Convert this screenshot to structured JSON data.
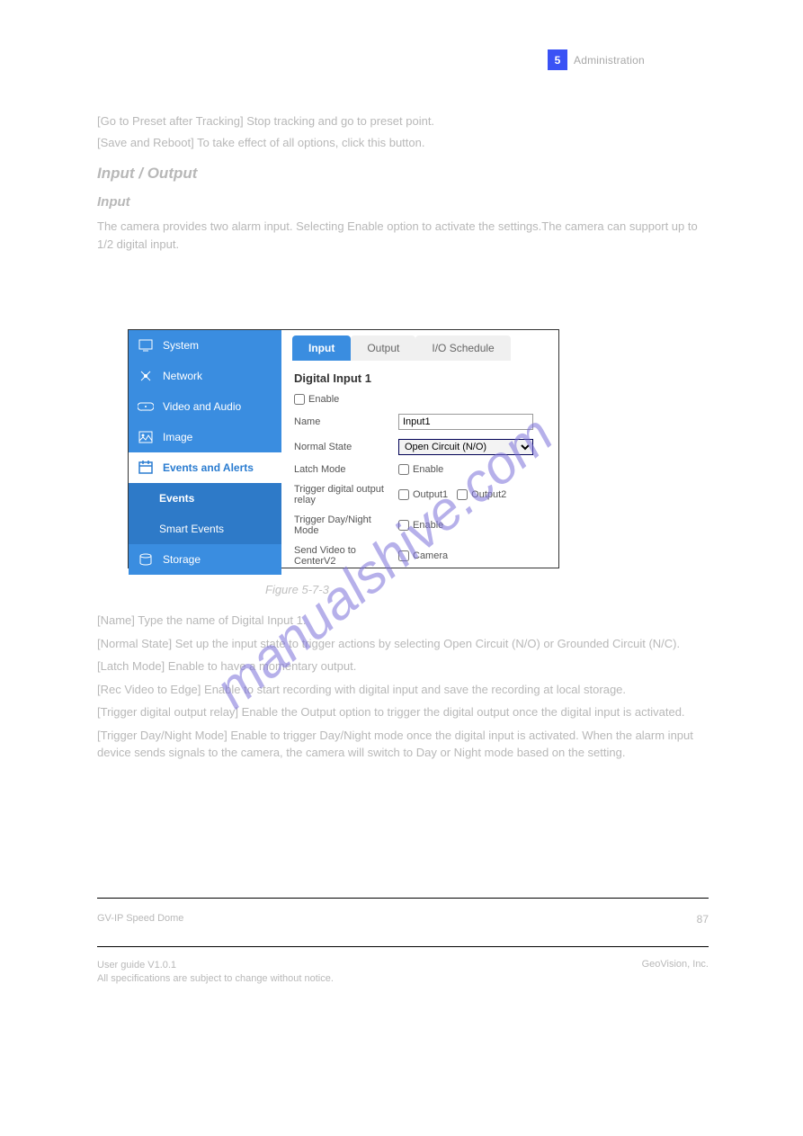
{
  "page": {
    "number": "5",
    "header_right_chapter": "Administration",
    "header_left": "Administration"
  },
  "intro": {
    "p1_bold": "[Go to Preset after Tracking]",
    "p1": " Stop tracking and go to preset point.",
    "p2_bold": "[Save and Reboot]",
    "p2": " To take effect of all options, click this button.",
    "section": "Input / Output",
    "subsection": "Input",
    "p3": "The camera provides two alarm input. Selecting Enable option to activate the settings.The camera can support up to 1/2 digital input."
  },
  "figure": {
    "sidebar": {
      "items": [
        {
          "label": "System"
        },
        {
          "label": "Network"
        },
        {
          "label": "Video and Audio"
        },
        {
          "label": "Image"
        },
        {
          "label": "Events and Alerts"
        },
        {
          "label": "Storage"
        }
      ],
      "active_index": 4,
      "submenu": [
        {
          "label": "Events"
        },
        {
          "label": "Smart Events"
        }
      ],
      "submenu_active_index": 0
    },
    "tabs": [
      {
        "label": "Input"
      },
      {
        "label": "Output"
      },
      {
        "label": "I/O Schedule"
      }
    ],
    "tabs_active_index": 0,
    "panel": {
      "title": "Digital Input 1",
      "enable_label": "Enable",
      "name_label": "Name",
      "name_value": "Input1",
      "normal_state_label": "Normal State",
      "normal_state_value": "Open Circuit (N/O)",
      "latch_label": "Latch Mode",
      "latch_enable": "Enable",
      "trigger_relay_label": "Trigger digital output relay",
      "output1": "Output1",
      "output2": "Output2",
      "trigger_dn_label": "Trigger Day/Night Mode",
      "trigger_dn_enable": "Enable",
      "sendvideo_label": "Send Video to CenterV2",
      "camera_label": "Camera"
    }
  },
  "caption": "Figure 5-7-3",
  "below": {
    "name_bold": "[Name]",
    "name_text": " Type the name of Digital Input 1.",
    "normal_bold": "[Normal State]",
    "normal_text": " Set up the input state to trigger actions by selecting Open Circuit (N/O) or Grounded Circuit (N/C).",
    "latch_bold": "[Latch Mode]",
    "latch_text": " Enable to have a momentary output.",
    "rec_bold": "[Rec Video to Edge]",
    "rec_text": " Enable to start recording with digital input and save the recording at local storage.",
    "relay_bold": "[Trigger digital output relay]",
    "relay_text": " Enable the Output option to trigger the digital output once the digital input is activated.",
    "dn_bold": "[Trigger Day/Night Mode]",
    "dn_text": " Enable to trigger Day/Night mode once the digital input is activated. When the alarm input device sends signals to the camera, the camera will switch to Day or Night mode based on the setting."
  },
  "footer": {
    "left": "GV-IP Speed Dome",
    "right": "87",
    "sub_left_line1": "User guide V1.0.1",
    "sub_left_line2": "All specifications are subject to change without notice.",
    "sub_right": "GeoVision, Inc."
  },
  "watermark_text": "manualshive.com"
}
